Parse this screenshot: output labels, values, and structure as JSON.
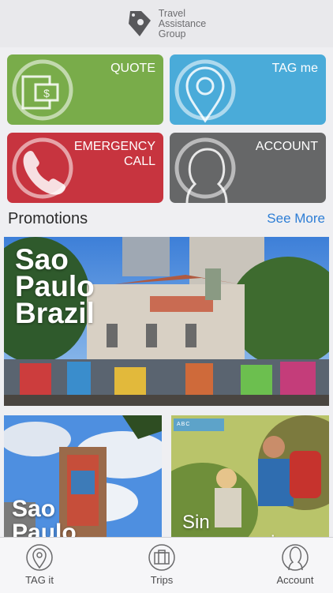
{
  "header": {
    "logo_line1": "Travel",
    "logo_line2": "Assistance",
    "logo_line3": "Group"
  },
  "tiles": {
    "quote": "QUOTE",
    "tag": "TAG me",
    "emergency_line1": "EMERGENCY",
    "emergency_line2": "CALL",
    "account": "ACCOUNT"
  },
  "promotions": {
    "title": "Promotions",
    "see_more": "See More",
    "cards": [
      {
        "title_line1": "Sao",
        "title_line2": "Paulo",
        "title_line3": "Brazil"
      },
      {
        "title_line1": "Sao",
        "title_line2": "Paulo"
      },
      {
        "badge": "ABC",
        "caption": "Sin preocupaciones"
      }
    ]
  },
  "tabbar": {
    "tab1": "TAG it",
    "tab2": "Trips",
    "tab3": "Account"
  },
  "colors": {
    "quote": "#79ac4a",
    "tag": "#4aabd9",
    "emergency": "#c7343f",
    "account": "#666768",
    "link": "#2e7ed5"
  }
}
